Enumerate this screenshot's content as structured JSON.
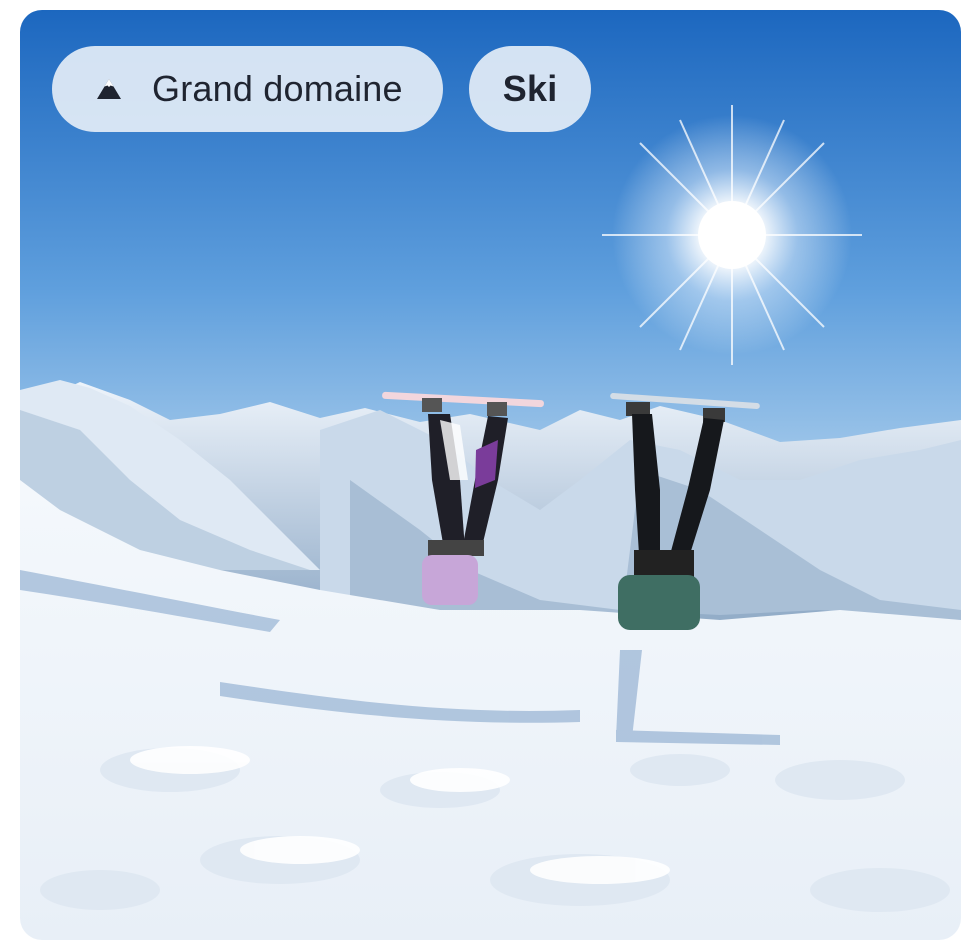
{
  "card": {
    "tags": [
      {
        "icon": "mountain-icon",
        "label": "Grand domaine"
      },
      {
        "icon": "",
        "label": "Ski"
      }
    ],
    "photo": {
      "subject": "Two people doing headstands with skis and snowboard in snowy mountains under bright sun"
    }
  },
  "colors": {
    "tag_bg": "#e2ecf6",
    "tag_text": "#1f2430",
    "sky_top": "#1f6fc4",
    "sky_bottom": "#cfe3f3",
    "snow": "#f6f9fc"
  }
}
